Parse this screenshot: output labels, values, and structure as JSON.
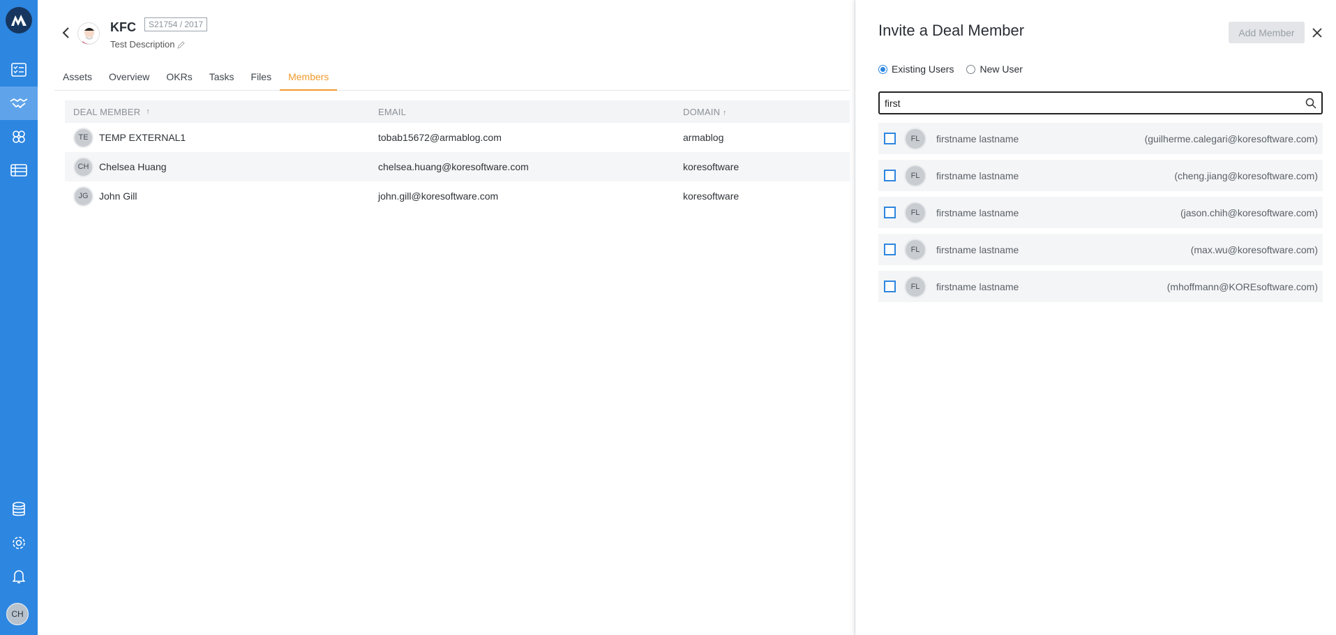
{
  "sidebar": {
    "items": [
      {
        "icon": "checklist-icon",
        "active": false
      },
      {
        "icon": "handshake-icon",
        "active": true
      },
      {
        "icon": "team-icon",
        "active": false
      },
      {
        "icon": "table-list-icon",
        "active": false
      },
      {
        "icon": "database-icon",
        "active": false
      },
      {
        "icon": "gear-icon",
        "active": false
      },
      {
        "icon": "bell-icon",
        "active": false
      }
    ],
    "avatar_initials": "CH"
  },
  "header": {
    "deal_name": "KFC",
    "deal_code": "S21754 / 2017",
    "description": "Test Description"
  },
  "tabs": [
    "Assets",
    "Overview",
    "OKRs",
    "Tasks",
    "Files",
    "Members"
  ],
  "active_tab": "Members",
  "table": {
    "columns": [
      "DEAL MEMBER",
      "EMAIL",
      "DOMAIN"
    ],
    "rows": [
      {
        "initials": "TE",
        "name": "TEMP EXTERNAL1",
        "email": "tobab15672@armablog.com",
        "domain": "armablog"
      },
      {
        "initials": "CH",
        "name": "Chelsea Huang",
        "email": "chelsea.huang@koresoftware.com",
        "domain": "koresoftware"
      },
      {
        "initials": "JG",
        "name": "John Gill",
        "email": "john.gill@koresoftware.com",
        "domain": "koresoftware"
      }
    ]
  },
  "panel": {
    "title": "Invite a Deal Member",
    "add_button": "Add Member",
    "radio_existing": "Existing Users",
    "radio_new": "New User",
    "search_value": "first",
    "users": [
      {
        "initials": "FL",
        "name": "firstname lastname",
        "email": "(guilherme.calegari@koresoftware.com)"
      },
      {
        "initials": "FL",
        "name": "firstname lastname",
        "email": "(cheng.jiang@koresoftware.com)"
      },
      {
        "initials": "FL",
        "name": "firstname lastname",
        "email": "(jason.chih@koresoftware.com)"
      },
      {
        "initials": "FL",
        "name": "firstname lastname",
        "email": "(max.wu@koresoftware.com)"
      },
      {
        "initials": "FL",
        "name": "firstname lastname",
        "email": "(mhoffmann@KOREsoftware.com)"
      }
    ]
  },
  "colors": {
    "sidebar": "#2d86e0",
    "accent": "#f09a2c"
  }
}
